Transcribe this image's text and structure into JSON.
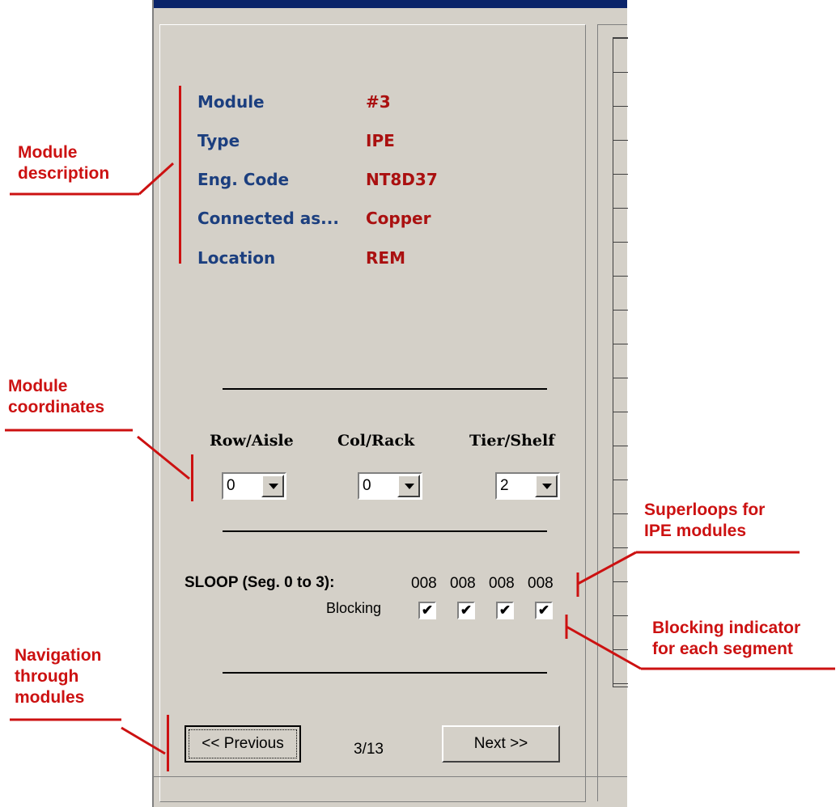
{
  "module_info": [
    {
      "label": "Module",
      "value": "#3"
    },
    {
      "label": "Type",
      "value": "IPE"
    },
    {
      "label": "Eng. Code",
      "value": "NT8D37"
    },
    {
      "label": "Connected as...",
      "value": "Copper"
    },
    {
      "label": "Location",
      "value": "REM"
    }
  ],
  "coordinates": {
    "row": {
      "label": "Row/Aisle",
      "value": "0"
    },
    "col": {
      "label": "Col/Rack",
      "value": "0"
    },
    "tier": {
      "label": "Tier/Shelf",
      "value": "2"
    }
  },
  "sloop": {
    "label": "SLOOP (Seg. 0 to 3):",
    "values": [
      "008",
      "008",
      "008",
      "008"
    ],
    "blocking_label": "Blocking",
    "blocking": [
      true,
      true,
      true,
      true
    ],
    "check_glyph": "✔"
  },
  "navigation": {
    "previous_label": "<< Previous",
    "page": "3/13",
    "next_label": "Next >>"
  },
  "annotations": {
    "module_description": [
      "Module",
      "description"
    ],
    "module_coordinates": [
      "Module",
      "coordinates"
    ],
    "superloops": [
      "Superloops for",
      "IPE modules"
    ],
    "blocking": [
      "Blocking indicator",
      "for each segment"
    ],
    "navigation": [
      "Navigation",
      "through",
      "modules"
    ]
  },
  "colors": {
    "label": "#1c3f7f",
    "value": "#aa1010",
    "annotation": "#cc1111",
    "panel": "#d4d0c8"
  }
}
